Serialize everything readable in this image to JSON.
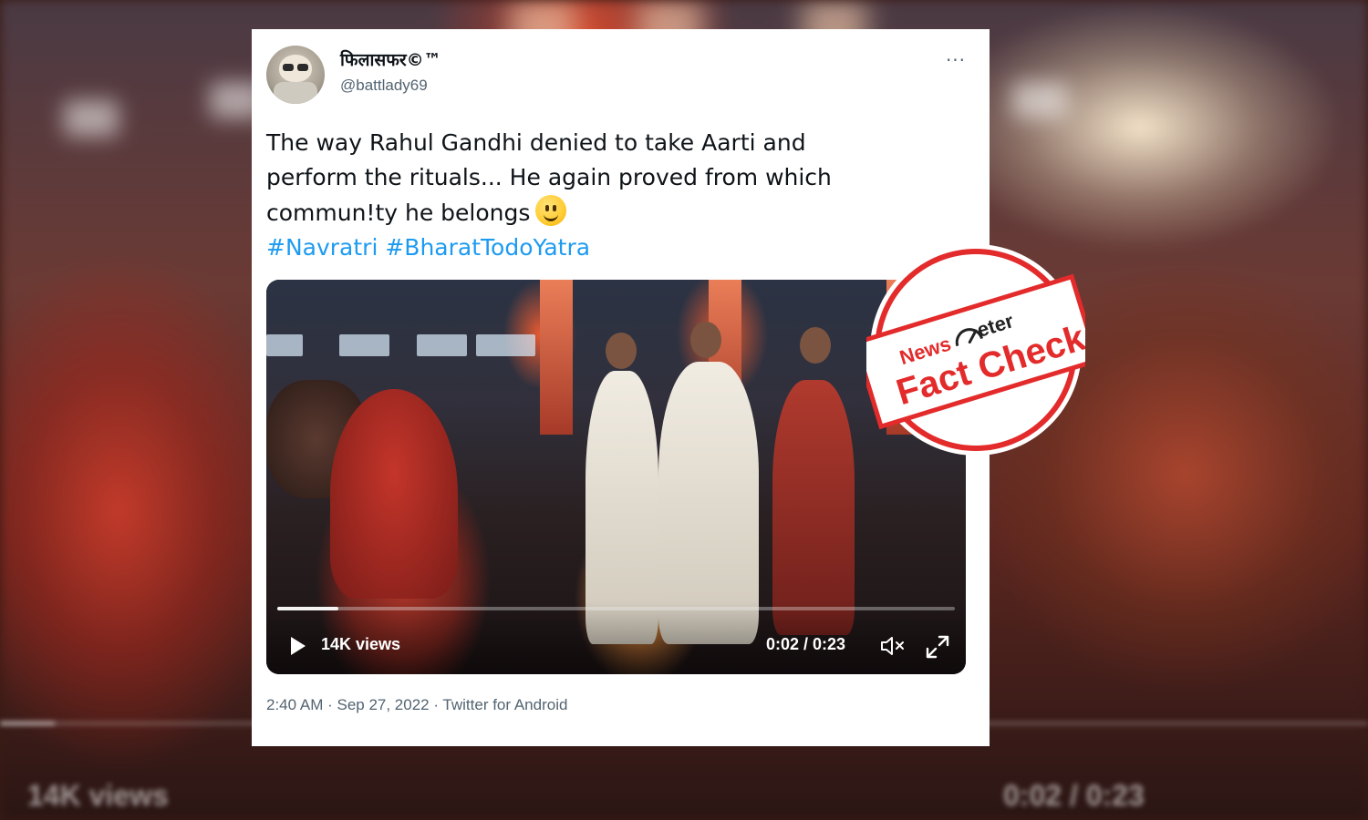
{
  "tweet": {
    "display_name": "फिलासफर©™",
    "handle": "@battlady69",
    "text_lines": [
      "The way Rahul Gandhi denied to take Aarti and",
      "perform the rituals... He again proved from which",
      "commun!ty he belongs"
    ],
    "hashtags": [
      "#Navratri",
      "#BharatTodoYatra"
    ],
    "more_label": "···",
    "meta": "2:40 AM · Sep 27, 2022 · Twitter for Android"
  },
  "video": {
    "views": "14K views",
    "time": "0:02 / 0:23",
    "progress_fraction": 0.09
  },
  "stamp": {
    "brand_top": "News",
    "brand_right": "eter",
    "label": "Fact Check",
    "color": "#e32b2b"
  },
  "background": {
    "views": "14K views",
    "time": "0:02 / 0:23"
  },
  "icons": [
    "play-icon",
    "mute-icon",
    "fullscreen-icon",
    "more-icon",
    "smiley-emoji-icon"
  ]
}
